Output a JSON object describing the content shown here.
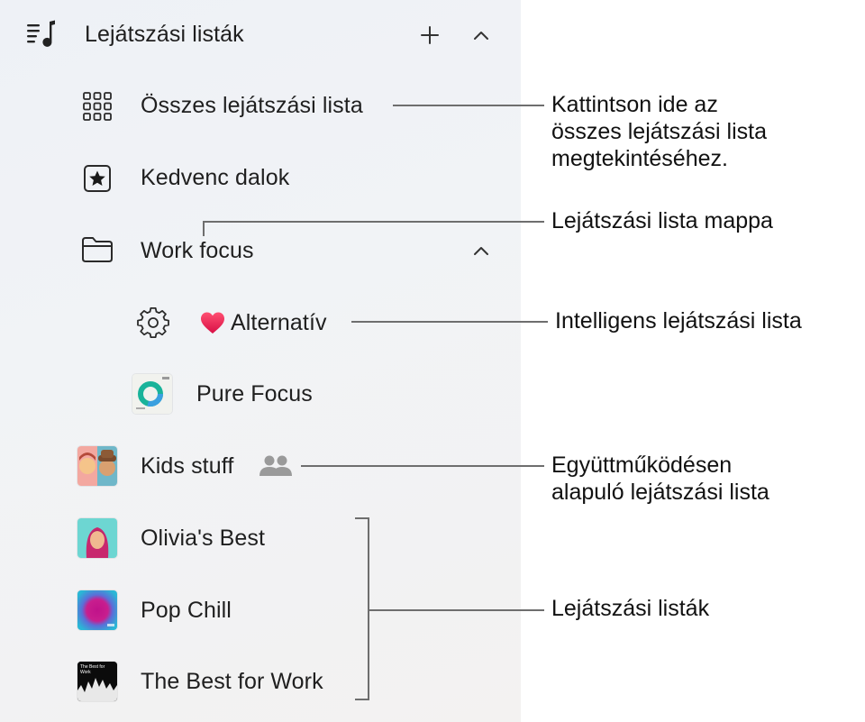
{
  "sidebar": {
    "section_title": "Lejátszási listák",
    "icons": {
      "section": "playlist-music-icon",
      "add": "plus-icon",
      "collapse": "chevron-up-icon"
    },
    "items": [
      {
        "label": "Összes lejátszási lista",
        "icon": "grid-icon"
      },
      {
        "label": "Kedvenc dalok",
        "icon": "star-square-icon"
      },
      {
        "label": "Work focus",
        "icon": "folder-icon",
        "expanded": true
      },
      {
        "label": "Alternatív",
        "icon": "gear-icon",
        "emoji": "❤️",
        "smart": true
      },
      {
        "label": "Pure Focus",
        "icon": "pure-focus-artwork"
      },
      {
        "label": "Kids stuff",
        "icon": "kids-stuff-artwork",
        "collaborative": true
      },
      {
        "label": "Olivia's Best",
        "icon": "olivia-artwork"
      },
      {
        "label": "Pop Chill",
        "icon": "pop-chill-artwork"
      },
      {
        "label": "The Best for Work",
        "icon": "best-for-work-artwork"
      }
    ],
    "artwork_text": {
      "best_for_work": "The Best for Work"
    }
  },
  "callouts": {
    "all_playlists": [
      "Kattintson ide az",
      "összes lejátszási lista",
      "megtekintéséhez."
    ],
    "folder": [
      "Lejátszási lista mappa"
    ],
    "smart": [
      "Intelligens lejátszási lista"
    ],
    "collab": [
      "Együttműködésen",
      "alapuló lejátszási lista"
    ],
    "playlists": [
      "Lejátszási listák"
    ]
  },
  "colors": {
    "sidebar_bg": "#f0f2f5",
    "heart": "#e8194a",
    "callout_line": "#6e6e6e"
  }
}
